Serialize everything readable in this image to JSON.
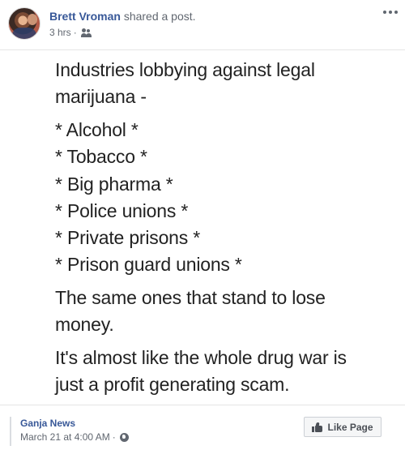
{
  "post": {
    "author_name": "Brett Vroman",
    "shared_text": "shared a post.",
    "time": "3 hrs",
    "separator": "·",
    "audience_icon": "friends-icon",
    "more_icon": "more-options-icon"
  },
  "image_text": {
    "heading_line1": "Industries lobbying against legal",
    "heading_line2": "marijuana -",
    "list": [
      "* Alcohol *",
      "* Tobacco *",
      "* Big pharma *",
      "* Police unions *",
      "* Private prisons *",
      "* Prison guard unions *"
    ],
    "para2_line1": "The same ones that stand to lose",
    "para2_line2": "money.",
    "para3_line1": "It's almost like the whole drug war is",
    "para3_line2": "just a profit generating scam."
  },
  "attribution": {
    "page_name": "Ganja News",
    "date": "March 21 at 4:00 AM",
    "separator": "·",
    "audience_icon": "globe-icon",
    "like_button_label": "Like Page",
    "like_icon": "thumbs-up-icon"
  },
  "colors": {
    "link_blue": "#385898",
    "meta_gray": "#616770",
    "button_bg": "#f5f6f7"
  }
}
